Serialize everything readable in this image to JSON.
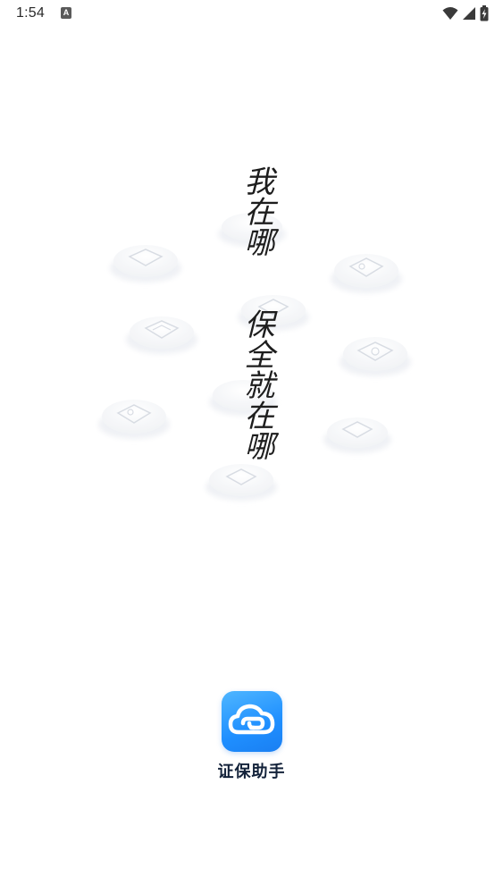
{
  "status_bar": {
    "time": "1:54",
    "notification_icon": "A"
  },
  "slogan": {
    "line1": "我在哪",
    "line2": "保全就在哪"
  },
  "app": {
    "name": "证保助手",
    "logo_icon": "cloud-link-icon",
    "brand_color": "#1f8fff"
  }
}
